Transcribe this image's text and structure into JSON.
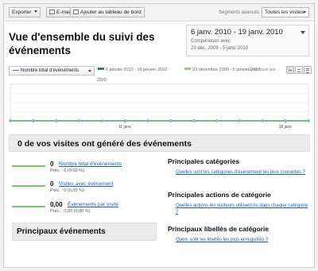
{
  "toolbar": {
    "export_label": "Exporter",
    "email_label": "E-mail",
    "dashboard_label": "Ajouter au tableau de bord",
    "segments_label": "Segments avancés :",
    "segments_value": "Toutes les visites"
  },
  "header": {
    "title": "Vue d'ensemble du suivi des événements",
    "date_range": "6 janv. 2010 - 19 janv. 2010",
    "compare_label": "Comparaison avec",
    "compare_range": "23 déc. 2009 - 5 janv. 2010"
  },
  "graph": {
    "metric_select": "Nombre total d'événements",
    "legend_current": "6 janvier 2010 - 19 janvier 2010",
    "legend_compare": "23 décembre 2009 - 5 janvier 2010",
    "graph_by_label": "Graphique par :",
    "year_label": "2010"
  },
  "chart_data": {
    "type": "line",
    "x_tick_labels": [
      "11 janv.",
      "18 janv."
    ],
    "series": [
      {
        "name": "6 janvier 2010 - 19 janvier 2010",
        "color": "#3a6ea5",
        "values": [
          0,
          0,
          0,
          0,
          0,
          0,
          0,
          0,
          0,
          0,
          0,
          0,
          0,
          0
        ]
      },
      {
        "name": "23 décembre 2009 - 5 janvier 2010",
        "color": "#9cc98a",
        "values": [
          0,
          0,
          0,
          0,
          0,
          0,
          0,
          0,
          0,
          0,
          0,
          0,
          0,
          0
        ]
      }
    ],
    "ylim": [
      0,
      1
    ],
    "grid": true
  },
  "summary": {
    "title": "0 de vos visites ont généré des événements",
    "metrics": [
      {
        "value": "0",
        "label": "Nombre total d'événements",
        "prev": "Préc. : 0 (0,00 %)"
      },
      {
        "value": "0",
        "label": "Visites avec événement",
        "prev": "Préc. : 0 (0,00 %)"
      },
      {
        "value": "0,00",
        "label": "Événements par visite",
        "prev": "Préc. : 0,00 (0,00 %)"
      }
    ]
  },
  "sections": {
    "top_events_title": "Principaux événements",
    "categories_title": "Principales catégories",
    "categories_link": "Quelles sont les catégories d'événement les plus courantes ?",
    "actions_title": "Principales actions de catégorie",
    "actions_link": "Quelles actions les visiteurs utilisent-ils dans chaque catégorie ?",
    "labels_title": "Principaux libellés de catégorie",
    "labels_link": "Quels sont les libellés les plus enregistrés ?"
  },
  "colors": {
    "link": "#1f5fb4",
    "current_series": "#3a6ea5",
    "compare_series": "#9cc98a"
  }
}
